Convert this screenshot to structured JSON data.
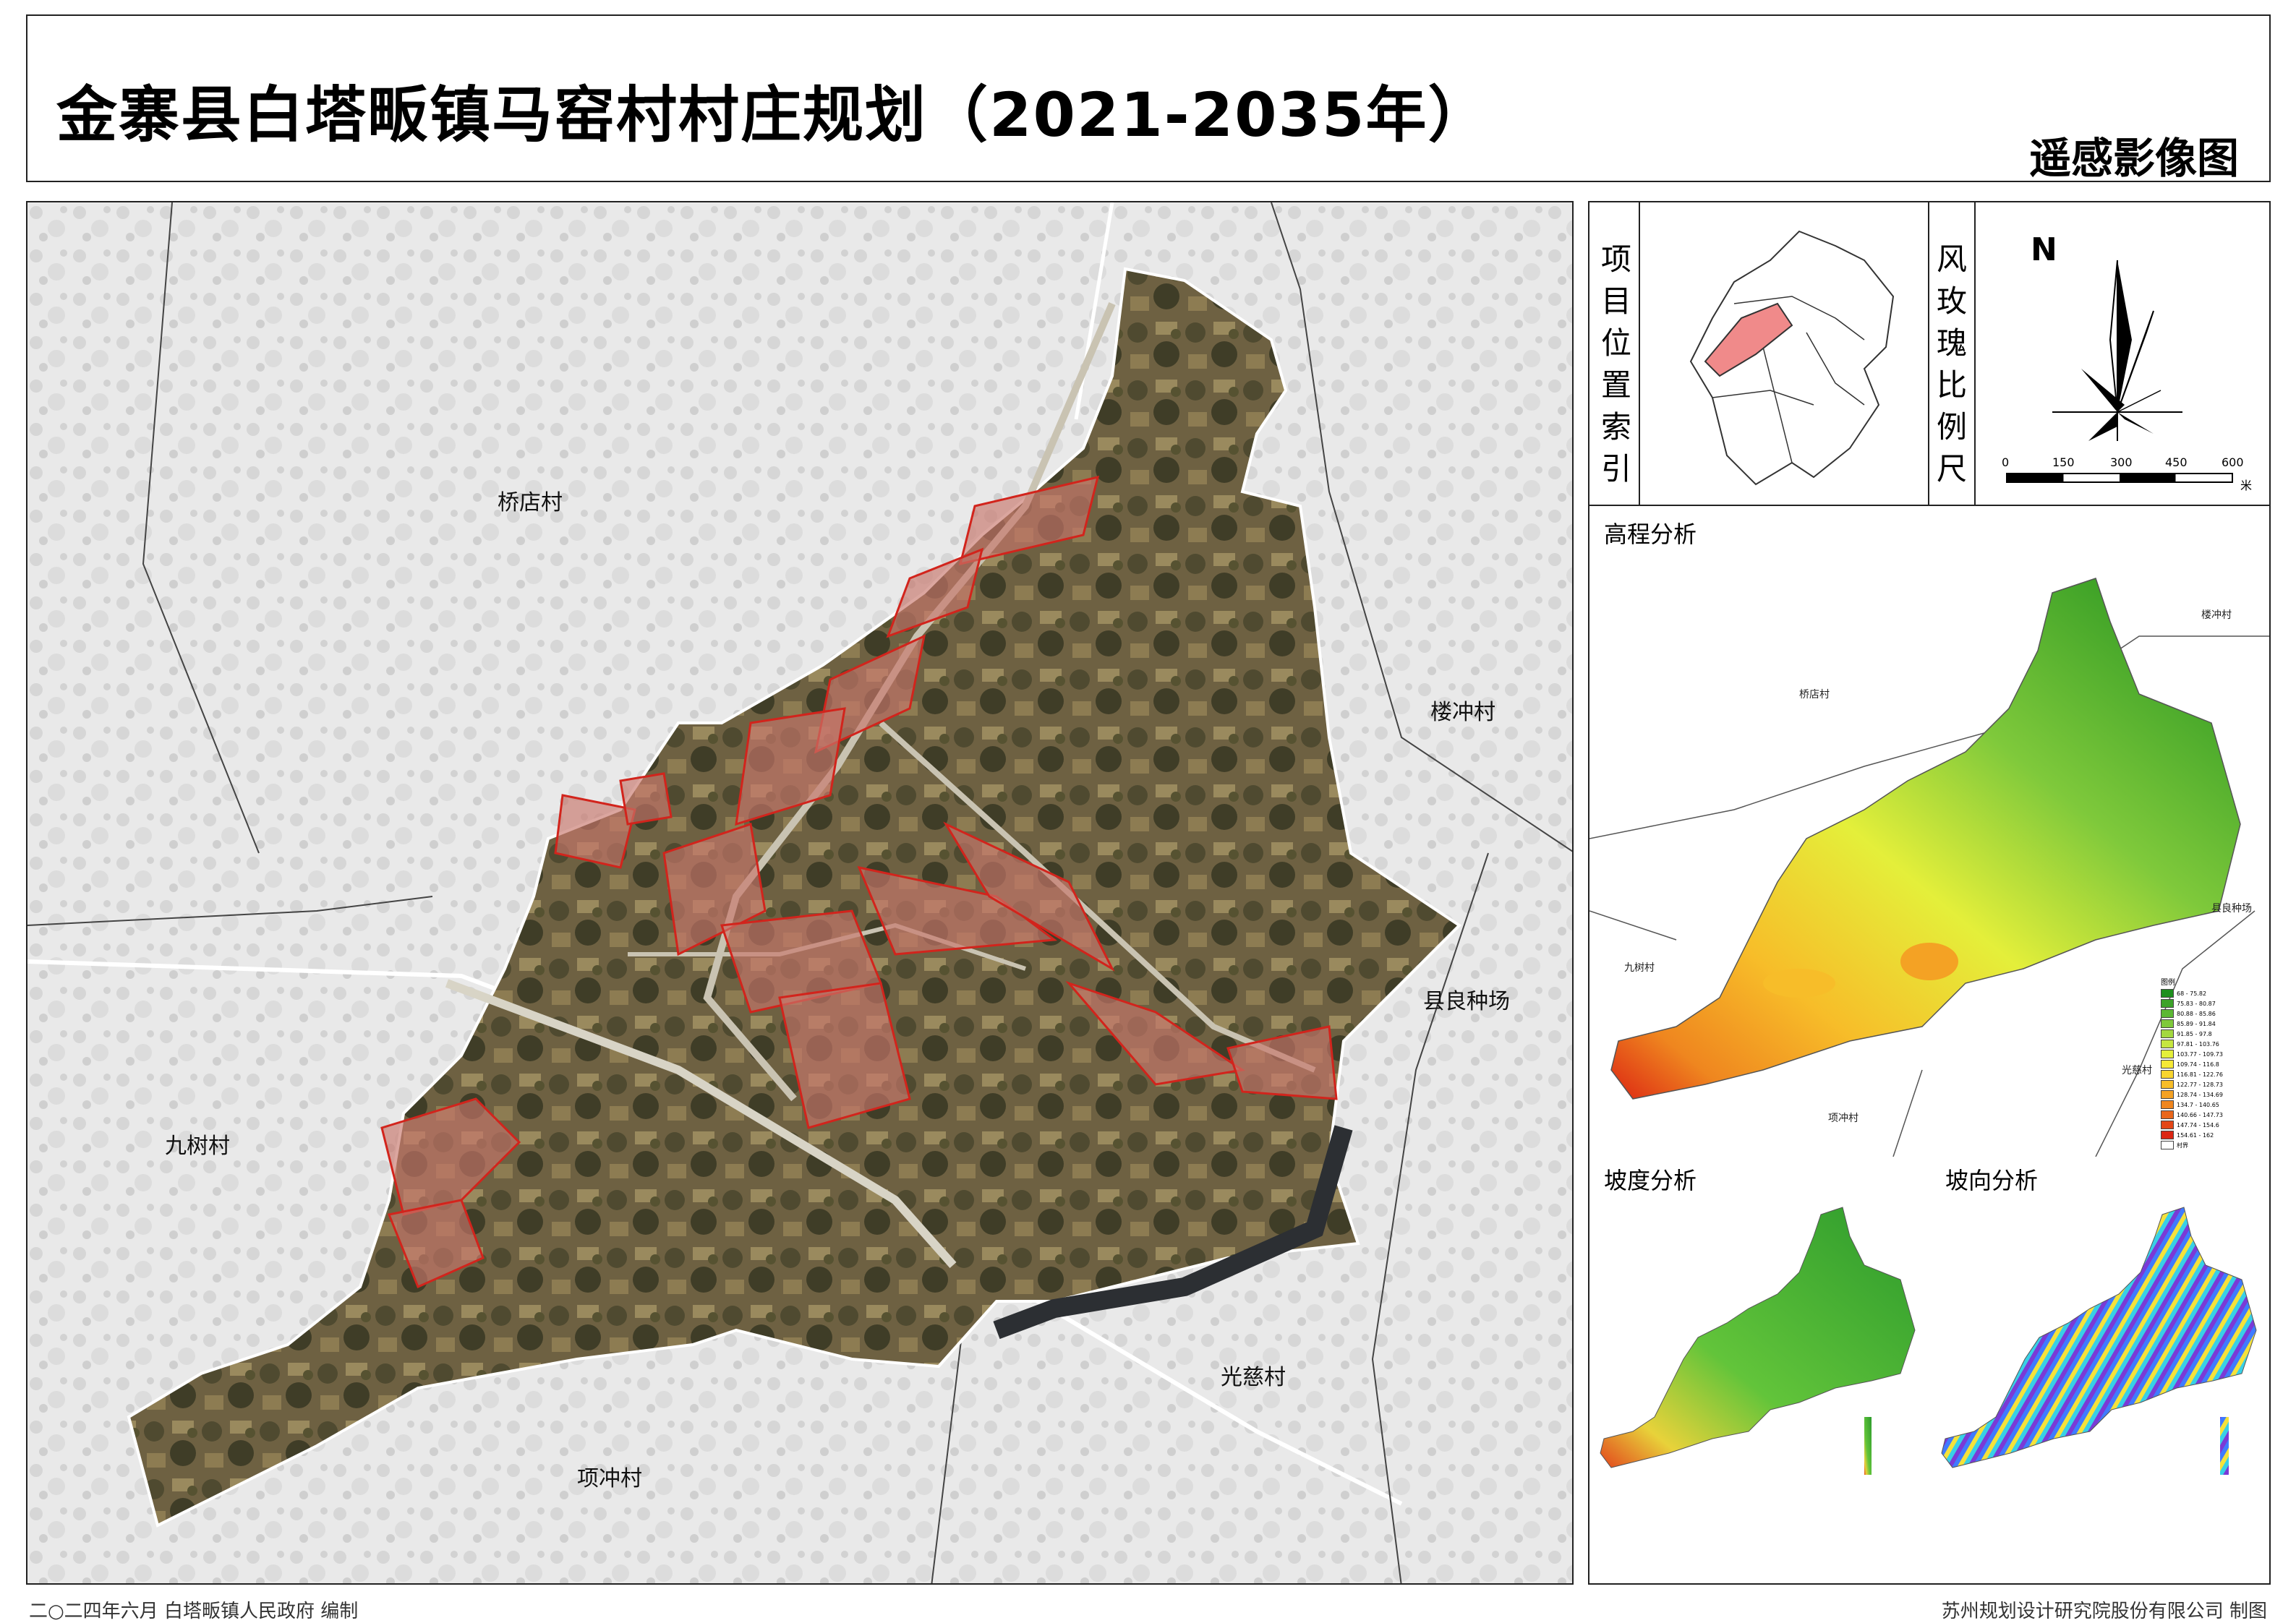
{
  "header": {
    "title": "金寨县白塔畈镇马窑村村庄规划（2021-2035年）",
    "map_type": "遥感影像图"
  },
  "main_map": {
    "village_labels": {
      "qiaodian": "桥店村",
      "louchong": "楼冲村",
      "xianliang": "县良种场",
      "jiushu": "九树村",
      "guangci": "光慈村",
      "xiangchong": "项冲村"
    }
  },
  "location_index": {
    "label": "项目位置索引"
  },
  "compass": {
    "label": "风玫瑰比例尺",
    "north": "N",
    "scale_ticks": [
      "0",
      "150",
      "300",
      "450",
      "600"
    ],
    "scale_unit": "米"
  },
  "elevation": {
    "title": "高程分析",
    "village_labels": {
      "qiaodian": "桥店村",
      "louchong": "楼冲村",
      "xianliang": "县良种场",
      "jiushu": "九树村",
      "guangci": "光慈村",
      "xiangchong": "项冲村"
    },
    "legend_title": "图例",
    "legend": [
      {
        "label": "68 - 75.82",
        "color": "#1e8f1e"
      },
      {
        "label": "75.83 - 80.87",
        "color": "#3da32a"
      },
      {
        "label": "80.88 - 85.86",
        "color": "#5cb834"
      },
      {
        "label": "85.89 - 91.84",
        "color": "#7fc93b"
      },
      {
        "label": "91.85 - 97.8",
        "color": "#a3d83f"
      },
      {
        "label": "97.81 - 103.76",
        "color": "#c6e63f"
      },
      {
        "label": "103.77 - 109.73",
        "color": "#e4ef3a"
      },
      {
        "label": "109.74 - 116.8",
        "color": "#f6e936"
      },
      {
        "label": "116.81 - 122.76",
        "color": "#f8d52f"
      },
      {
        "label": "122.77 - 128.73",
        "color": "#f7bd29"
      },
      {
        "label": "128.74 - 134.69",
        "color": "#f4a224"
      },
      {
        "label": "134.7 - 140.65",
        "color": "#ef861f"
      },
      {
        "label": "140.66 - 147.73",
        "color": "#e9661b"
      },
      {
        "label": "147.74 - 154.6",
        "color": "#e44617"
      },
      {
        "label": "154.61 - 162",
        "color": "#dc2613"
      },
      {
        "label": "村界",
        "color": "#ffffff"
      }
    ]
  },
  "slope": {
    "title": "坡度分析"
  },
  "aspect": {
    "title": "坡向分析"
  },
  "footer": {
    "left": "二○二四年六月  白塔畈镇人民政府  编制",
    "right": "苏州规划设计研究院股份有限公司  制图"
  }
}
